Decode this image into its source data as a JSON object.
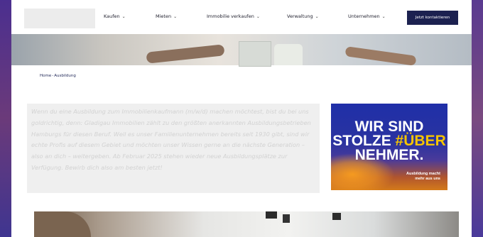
{
  "nav": {
    "items": [
      {
        "label": "Kaufen",
        "icon": "chevron-down-icon"
      },
      {
        "label": "Mieten",
        "icon": "chevron-down-icon"
      },
      {
        "label": "Immobilie verkaufen",
        "icon": "chevron-down-icon"
      },
      {
        "label": "Verwaltung",
        "icon": "chevron-down-icon"
      },
      {
        "label": "Unternehmen",
        "icon": "chevron-down-icon"
      }
    ],
    "chevron": "⌄",
    "cta_label": "Jetzt kontaktieren"
  },
  "breadcrumb": {
    "home": "Home",
    "separator": "-",
    "current": "Ausbildung"
  },
  "main": {
    "intro_text": "Wenn du eine Ausbildung zum Immobilienkaufmann (m/w/d) machen möchtest, bist du bei uns goldrichtig, denn: Gladigau Immobilien zählt zu den größten anerkannten Ausbildungsbetrieben Hamburgs für diesen Beruf. Weil es unser Familienunternehmen bereits seit 1930 gibt, sind wir echte Profis auf diesem Gebiet und möchten unser Wissen gerne an die nächste Generation – also an dich – weitergeben. Ab Februar 2025 stehen wieder neue Ausbildungsplätze zur Verfügung. Bewirb dich also am besten jetzt!"
  },
  "banner": {
    "line1": "WIR SIND",
    "line2_prefix": "STOLZE ",
    "line2_highlight": "#ÜBER",
    "line3": "NEHMER.",
    "sub_line1": "Ausbildung macht",
    "sub_line2": "mehr aus uns"
  },
  "colors": {
    "brand_navy": "#1c2150",
    "banner_blue": "#1f2fa8",
    "banner_yellow": "#f5c400",
    "banner_orange": "#d47a1a"
  }
}
